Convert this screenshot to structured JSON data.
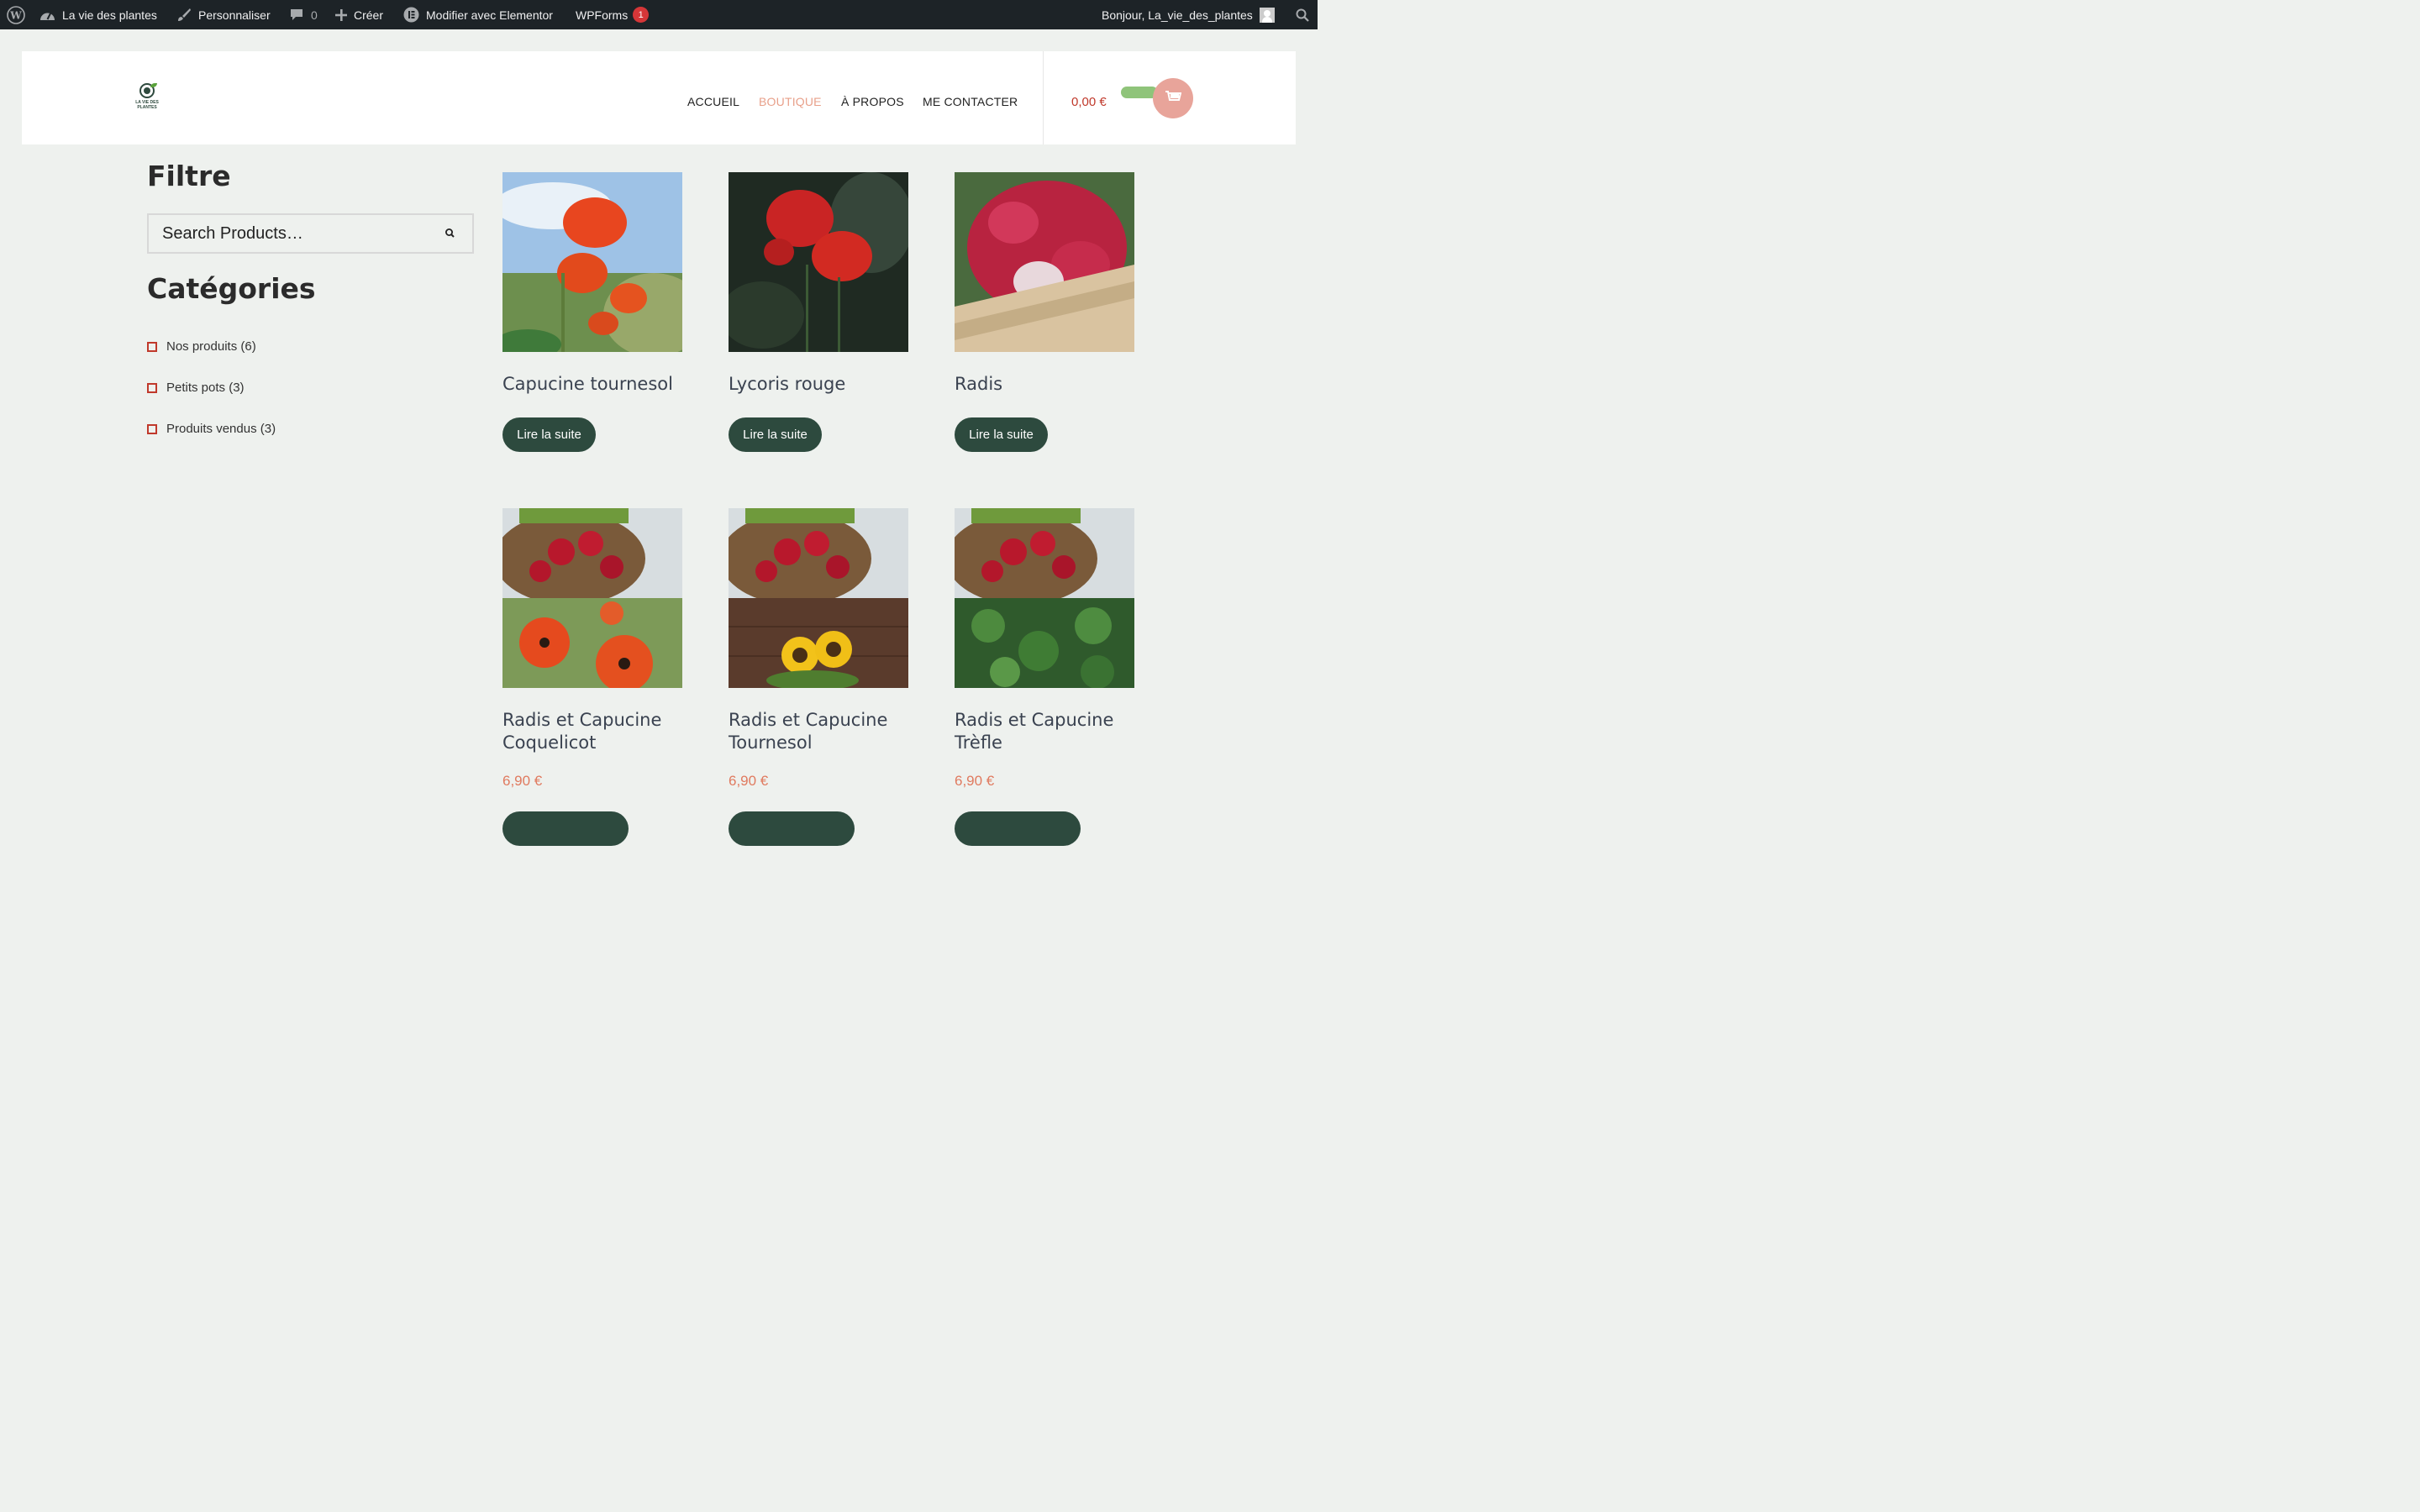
{
  "admin_bar": {
    "site_name": "La vie des plantes",
    "customize": "Personnaliser",
    "comments_count": "0",
    "new": "Créer",
    "elementor": "Modifier avec Elementor",
    "wpforms": "WPForms",
    "wpforms_badge": "1",
    "greeting": "Bonjour, La_vie_des_plantes"
  },
  "header": {
    "logo_text": "LA VIE DES PLANTES",
    "nav": [
      "ACCUEIL",
      "BOUTIQUE",
      "À PROPOS",
      "ME CONTACTER"
    ],
    "active_nav": "BOUTIQUE",
    "cart_total": "0,00 €"
  },
  "sidebar": {
    "filter_title": "Filtre",
    "search_placeholder": "Search Products…",
    "categories_title": "Catégories",
    "categories": [
      "Nos produits (6)",
      "Petits pots (3)",
      "Produits vendus (3)"
    ]
  },
  "products": [
    {
      "title": "Capucine tournesol",
      "button": "Lire la suite"
    },
    {
      "title": "Lycoris rouge",
      "button": "Lire la suite"
    },
    {
      "title": "Radis",
      "button": "Lire la suite"
    },
    {
      "title": "Radis et Capucine Coquelicot",
      "price": "6,90 €"
    },
    {
      "title": "Radis et Capucine Tournesol",
      "price": "6,90 €"
    },
    {
      "title": "Radis et Capucine Trèfle",
      "price": "6,90 €"
    }
  ],
  "colors": {
    "admin_bar": "#1d2327",
    "page_bg": "#eef1ee",
    "button_green": "#2d4a3e",
    "price": "#e07a5f",
    "nav_active": "#e8a08a"
  }
}
